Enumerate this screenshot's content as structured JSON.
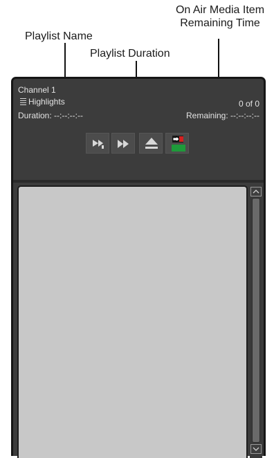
{
  "annotations": {
    "on_air_line1": "On Air Media Item",
    "on_air_line2": "Remaining Time",
    "playlist_name": "Playlist Name",
    "playlist_duration": "Playlist Duration"
  },
  "panel": {
    "channel": "Channel 1",
    "playlist_name": "Highlights",
    "count": "0 of 0",
    "duration": "Duration: --:--:--:--",
    "remaining": "Remaining: --:--:--:--"
  },
  "controls": [
    {
      "icon": "play-next-icon"
    },
    {
      "icon": "fast-forward-icon"
    },
    {
      "icon": "eject-icon"
    },
    {
      "icon": "on-air-status-icon"
    }
  ],
  "colors": {
    "panel_bg": "#3c3c3c",
    "list_bg": "#c8c8c8",
    "on_air_red": "#d42020",
    "on_air_green": "#1e9a3a"
  }
}
